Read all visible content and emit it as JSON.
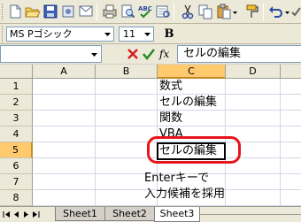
{
  "toolbar": {
    "icons": [
      "new-icon",
      "open-icon",
      "save-icon",
      "permission-icon",
      "email-icon",
      "print-icon",
      "print-preview-icon",
      "spelling-icon",
      "research-icon",
      "cut-icon",
      "copy-icon",
      "paste-icon",
      "format-painter-icon"
    ]
  },
  "format_bar": {
    "font_name": "MS Pゴシック",
    "font_size": "11",
    "bold_label": "B"
  },
  "formula_bar": {
    "name_box": "",
    "fx_label": "fx",
    "content": "セルの編集"
  },
  "grid": {
    "columns": [
      "A",
      "B",
      "C",
      "D"
    ],
    "selected_column": "C",
    "rows": [
      "1",
      "2",
      "3",
      "4",
      "5",
      "6",
      "7",
      "8"
    ],
    "selected_row": "5",
    "cells_c": [
      "数式",
      "セルの編集",
      "関数",
      "VBA",
      "セルの編集"
    ]
  },
  "annotation": {
    "line1": "Enterキーで",
    "line2": "入力候補を採用",
    "ring_color": "#e8141b"
  },
  "sheets": {
    "tabs": [
      "Sheet1",
      "Sheet2",
      "Sheet3"
    ],
    "active": "Sheet3"
  }
}
